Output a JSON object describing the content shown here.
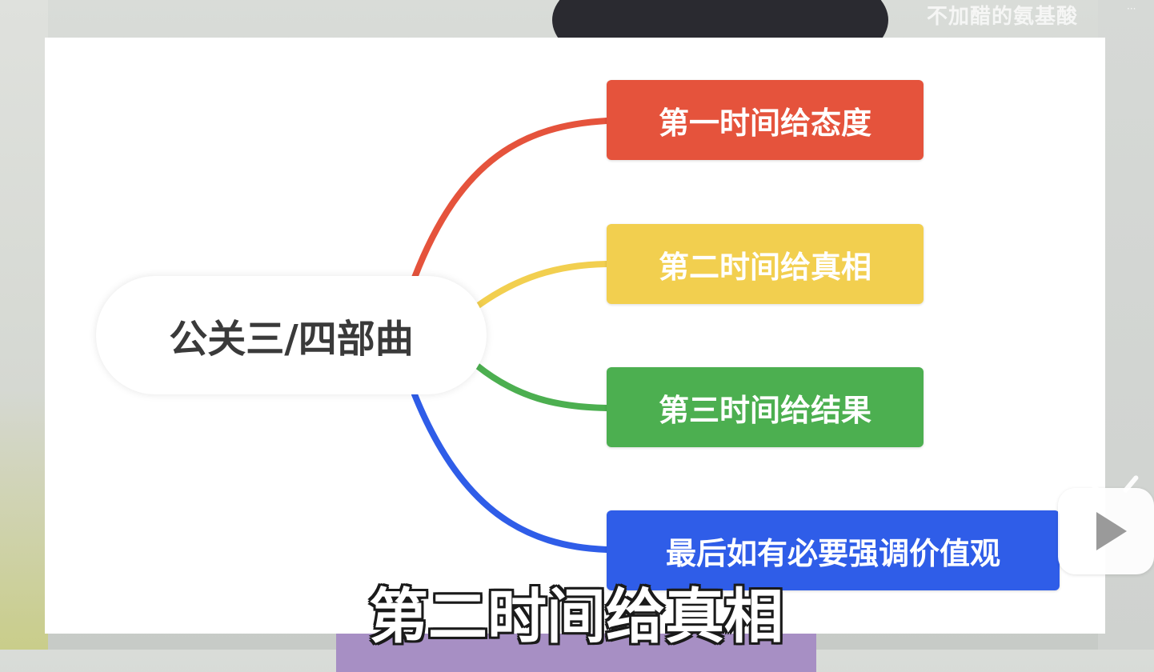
{
  "watermark": "不加醋的氨基酸",
  "corner_mark": "···",
  "mindmap": {
    "root": "公关三/四部曲",
    "branches": [
      {
        "label": "第一时间给态度",
        "color": "#e5533c"
      },
      {
        "label": "第二时间给真相",
        "color": "#f2cf4f"
      },
      {
        "label": "第三时间给结果",
        "color": "#4caf50"
      },
      {
        "label": "最后如有必要强调价值观",
        "color": "#2f5de8"
      }
    ]
  },
  "subtitle": "第二时间给真相",
  "colors": {
    "slide_bg": "#ffffff",
    "root_text": "#3a3a3a",
    "subtitle_text": "#ffffff",
    "subtitle_outline": "#1a1a1a"
  }
}
